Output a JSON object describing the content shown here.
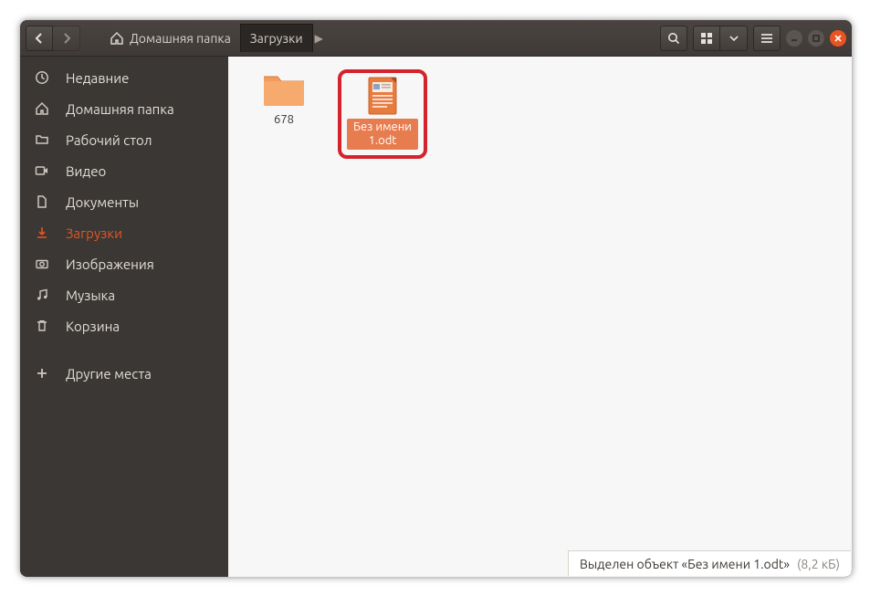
{
  "header": {
    "breadcrumbs": [
      {
        "label": "Домашняя папка",
        "active": false
      },
      {
        "label": "Загрузки",
        "active": true
      }
    ]
  },
  "sidebar": {
    "items": [
      {
        "icon": "recent",
        "label": "Недавние"
      },
      {
        "icon": "home",
        "label": "Домашняя папка"
      },
      {
        "icon": "desktop",
        "label": "Рабочий стол"
      },
      {
        "icon": "videos",
        "label": "Видео"
      },
      {
        "icon": "documents",
        "label": "Документы"
      },
      {
        "icon": "downloads",
        "label": "Загрузки",
        "active": true
      },
      {
        "icon": "pictures",
        "label": "Изображения"
      },
      {
        "icon": "music",
        "label": "Музыка"
      },
      {
        "icon": "trash",
        "label": "Корзина"
      }
    ],
    "other_places_label": "Другие места"
  },
  "content": {
    "items": [
      {
        "type": "folder",
        "name": "678",
        "selected": false
      },
      {
        "type": "document",
        "name": "Без имени 1.odt",
        "selected": true,
        "highlighted": true
      }
    ]
  },
  "statusbar": {
    "text": "Выделен объект «Без имени 1.odt»",
    "size": "(8,2 кБ)"
  },
  "colors": {
    "accent": "#e95420",
    "headerbar_bg": "#3f3a37",
    "sidebar_bg": "#3b3734",
    "highlight_border": "#d5232c"
  }
}
